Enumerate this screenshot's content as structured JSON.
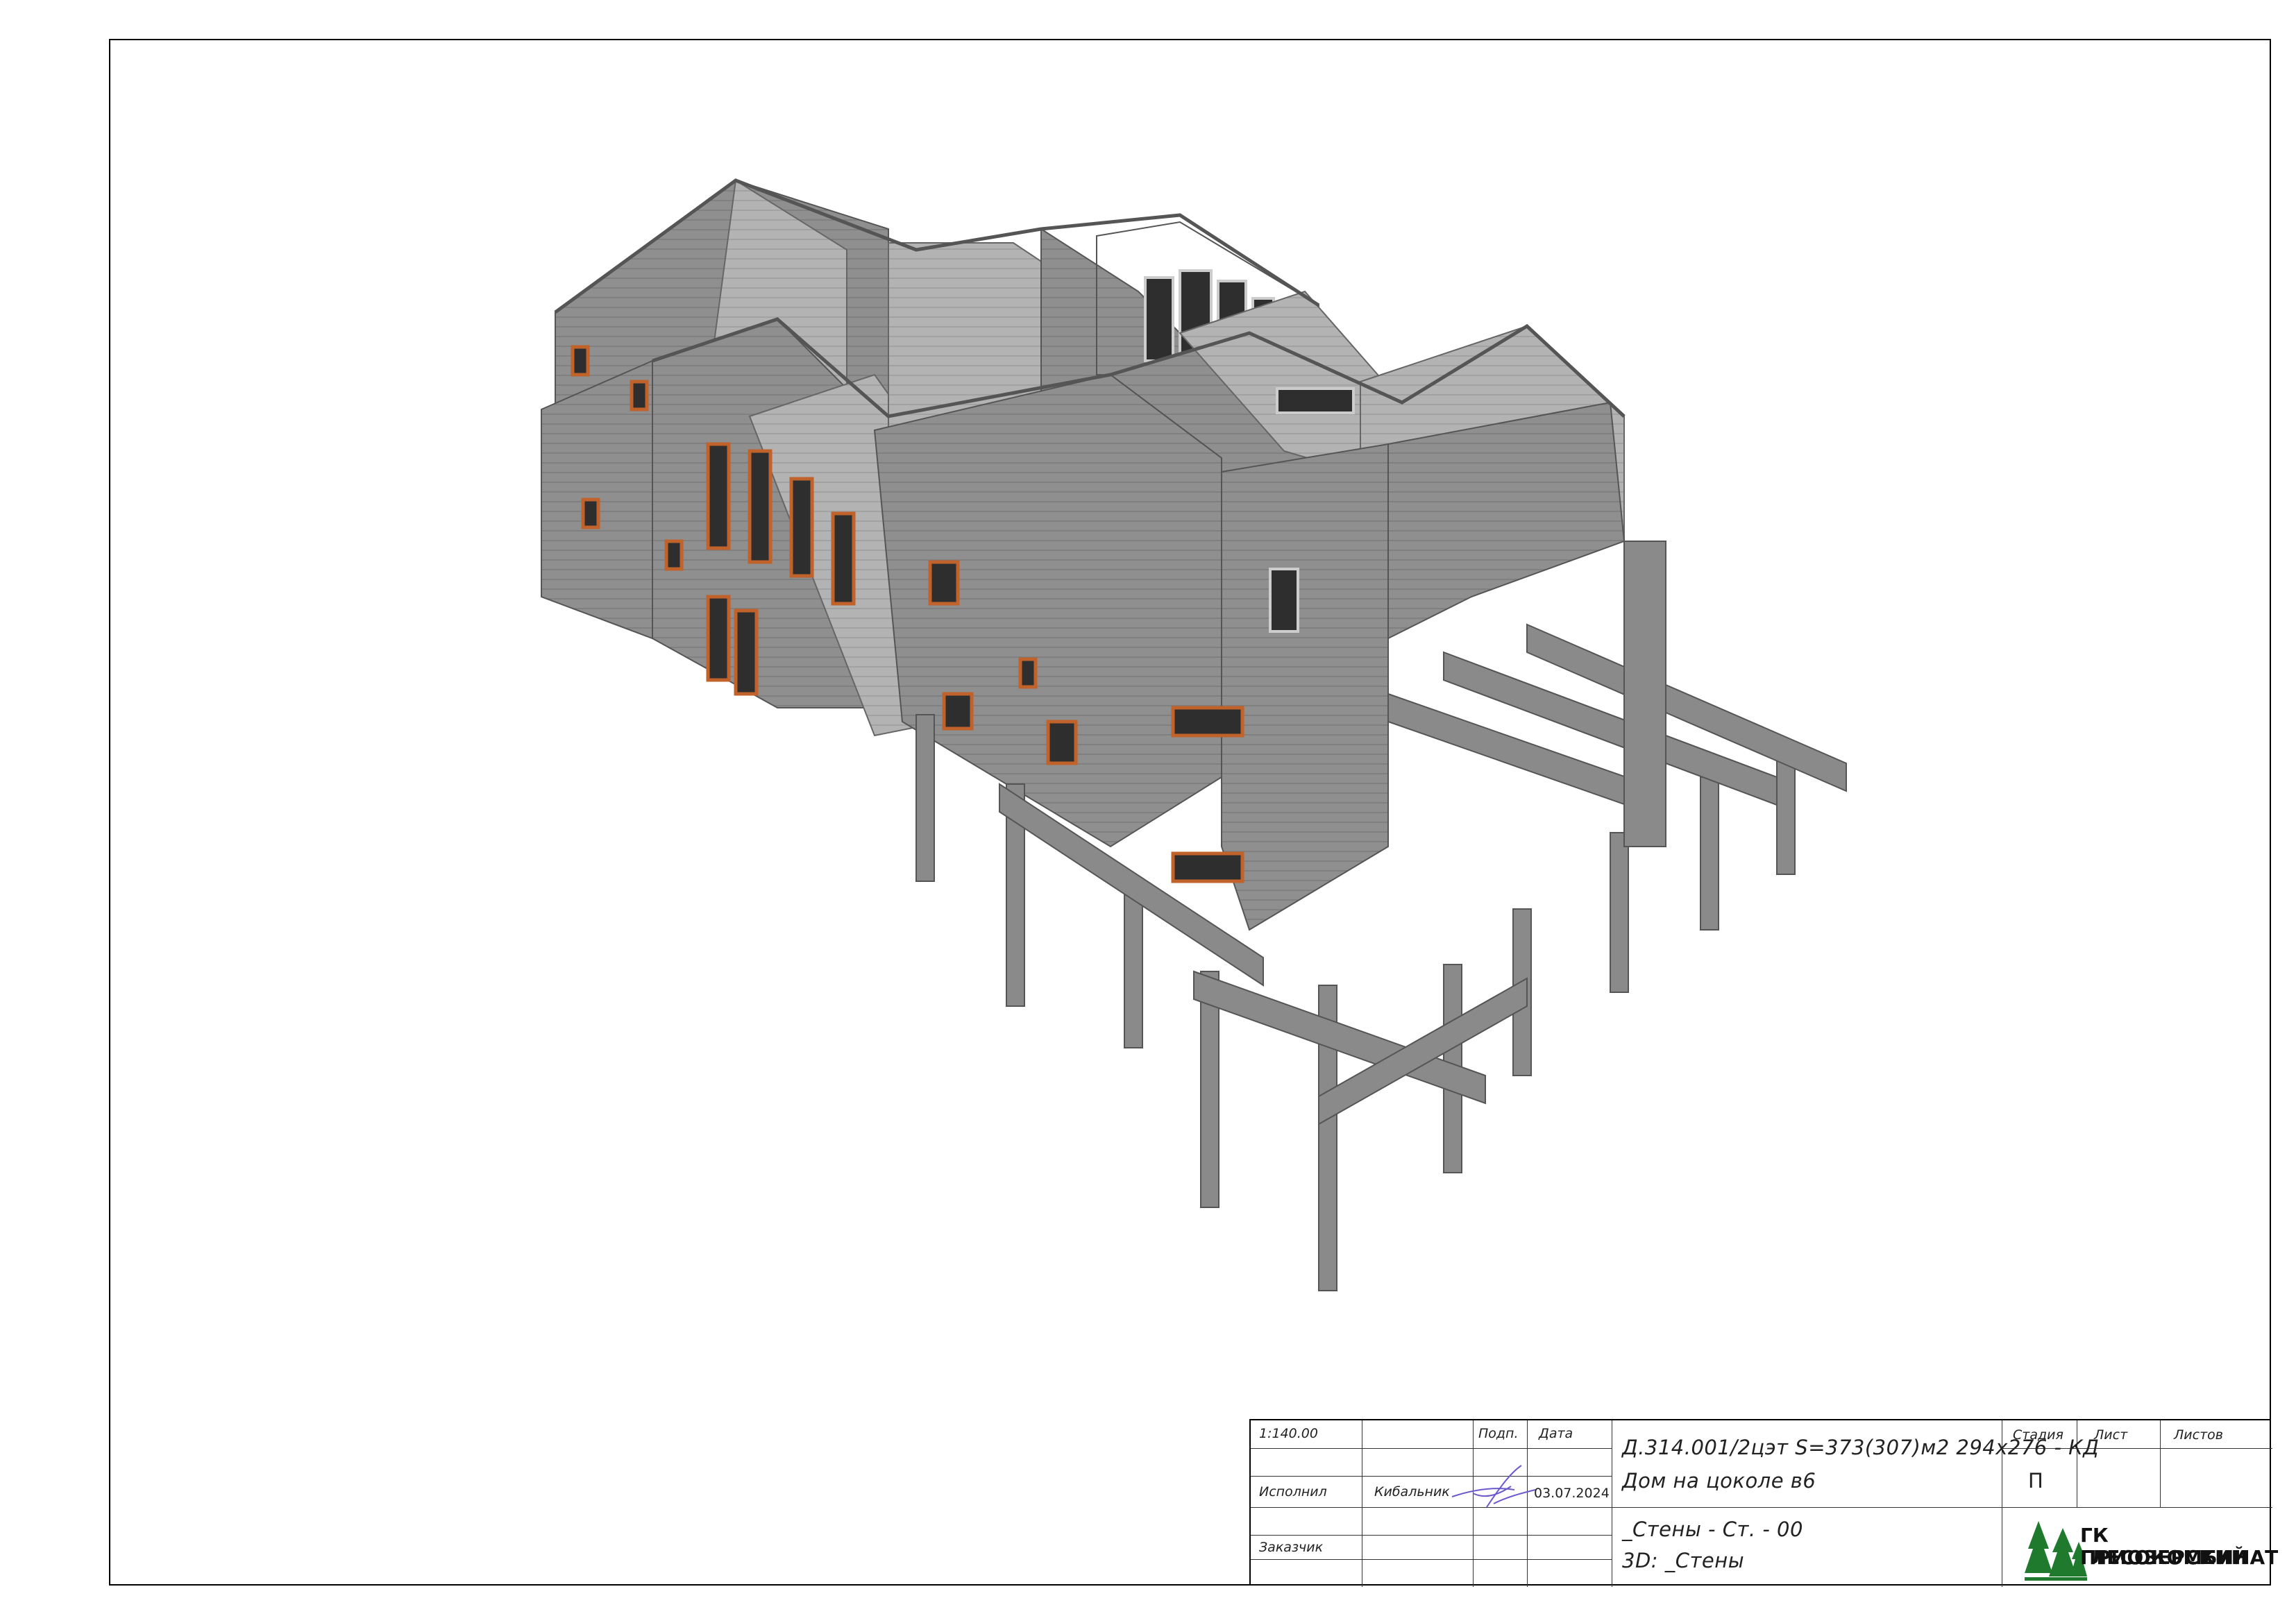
{
  "stamp": {
    "scale": "1:140.00",
    "performed_label": "Исполнил",
    "performer_name": "Кибальник",
    "customer_label": "Заказчик",
    "sign_header": "Подп.",
    "date_header": "Дата",
    "date_value": "03.07.2024",
    "doc_code": "Д.314.001/2цэт S=373(307)м2 294х276 - КД",
    "doc_title": "Дом на цоколе в6",
    "view_line1": "_Стены - Ст. - 00",
    "view_line2": "3D: _Стены",
    "stage_header": "Стадия",
    "sheet_header": "Лист",
    "sheets_header": "Листов",
    "stage_value": "П",
    "company_line1": "ГК ПРИОЗЕРСКИЙ",
    "company_line2": "ЛЕСОКОМБИНАТ"
  },
  "colors": {
    "wall": "#8f8f8f",
    "wall_light": "#b4b4b4",
    "wall_dark": "#6e6e6e",
    "window_frame": "#c0622a",
    "glass": "#2e2e2e",
    "logo_green": "#1f7a2e"
  },
  "icons": [
    "signature-icon",
    "spruce-trees-logo-icon"
  ]
}
